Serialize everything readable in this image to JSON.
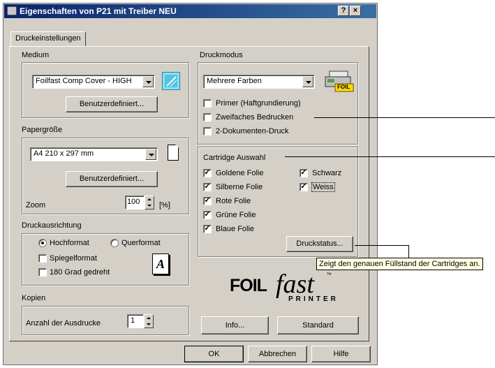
{
  "window": {
    "title": "Eigenschaften von P21 mit Treiber NEU",
    "help_btn": "?",
    "close_btn": "×"
  },
  "tab": {
    "label": "Druckeinstellungen"
  },
  "medium": {
    "label": "Medium",
    "value": "Foilfast Comp Cover - HIGH",
    "custom_btn": "Benutzerdefiniert..."
  },
  "paper": {
    "label": "Papergröße",
    "value": "A4 210 x 297 mm",
    "custom_btn": "Benutzerdefiniert...",
    "zoom_label": "Zoom",
    "zoom_value": "100",
    "zoom_unit": "[%]"
  },
  "orientation": {
    "label": "Druckausrichtung",
    "portrait": "Hochformat",
    "landscape": "Querformat",
    "mirror": "Spiegelformat",
    "rotate": "180 Grad gedreht",
    "preview_glyph": "A"
  },
  "copies": {
    "label": "Kopien",
    "count_label": "Anzahl der Ausdrucke",
    "count_value": "1"
  },
  "printmode": {
    "label": "Druckmodus",
    "value": "Mehrere Farben",
    "primer": "Primer (Haftgrundierung)",
    "double": "Zweifaches Bedrucken",
    "twodoc": "2-Dokumenten-Druck",
    "printer_badge": "FOIL"
  },
  "cartridge": {
    "label": "Cartridge Auswahl",
    "gold": "Goldene Folie",
    "silver": "Silberne Folie",
    "red": "Rote Folie",
    "green": "Grüne Folie",
    "blue": "Blaue Folie",
    "black": "Schwarz",
    "white": "Weiss",
    "status_btn": "Druckstatus..."
  },
  "tooltip": "Zeigt den genauen Füllstand der Cartridges an.",
  "logo": {
    "foil": "FOIL",
    "fast": "fast",
    "tm": "™",
    "printer": "PRINTER"
  },
  "footer": {
    "info_btn": "Info...",
    "standard_btn": "Standard",
    "ok_btn": "OK",
    "cancel_btn": "Abbrechen",
    "help_btn": "Hilfe"
  },
  "colors": {
    "title_start": "#0a246a",
    "title_end": "#3a6ea5",
    "face": "#d4d0c8",
    "tooltip_bg": "#ffffe1"
  }
}
